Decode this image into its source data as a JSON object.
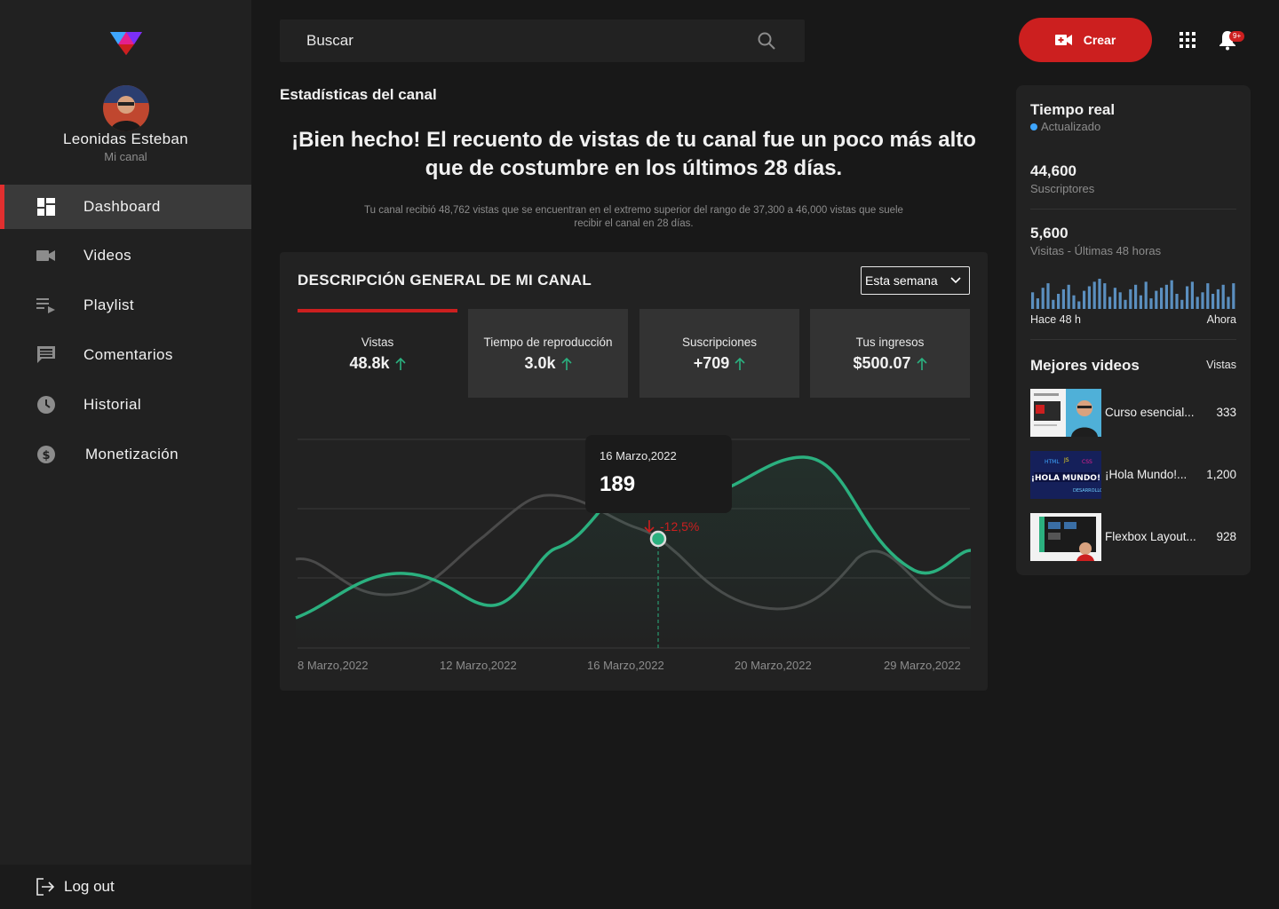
{
  "user": {
    "name": "Leonidas Esteban",
    "subtitle": "Mi canal"
  },
  "nav": [
    {
      "label": "Dashboard",
      "icon": "dashboard-icon",
      "active": true
    },
    {
      "label": "Videos",
      "icon": "video-camera-icon"
    },
    {
      "label": "Playlist",
      "icon": "playlist-icon"
    },
    {
      "label": "Comentarios",
      "icon": "comment-icon"
    },
    {
      "label": "Historial",
      "icon": "clock-icon"
    },
    {
      "label": "Monetización",
      "icon": "dollar-icon"
    }
  ],
  "logout_label": "Log out",
  "search": {
    "placeholder": "Buscar"
  },
  "create_label": "Crear",
  "notifications_badge": "9+",
  "page_title": "Estadísticas del canal",
  "headline": "¡Bien hecho! El recuento de vistas de tu canal fue un poco más alto que de costumbre en los últimos 28 días.",
  "subline": "Tu canal recibió 48,762 vistas que se encuentran en el extremo superior del rango de 37,300 a 46,000 vistas que suele recibir el canal en 28 días.",
  "overview": {
    "title": "DESCRIPCIÓN GENERAL DE MI CANAL",
    "period": "Esta semana",
    "metrics": [
      {
        "label": "Vistas",
        "value": "48.8k",
        "active": true
      },
      {
        "label": "Tiempo de reproducción",
        "value": "3.0k"
      },
      {
        "label": "Suscripciones",
        "value": "+709"
      },
      {
        "label": "Tus ingresos",
        "value": "$500.07"
      }
    ],
    "tooltip": {
      "date": "16 Marzo,2022",
      "value": "189",
      "delta": "-12,5%"
    }
  },
  "chart_data": {
    "type": "line",
    "x_tick_labels": [
      "8 Marzo,2022",
      "12 Marzo,2022",
      "16 Marzo,2022",
      "20 Marzo,2022",
      "29 Marzo,2022"
    ],
    "grid": true,
    "colors": {
      "current": "#2bb07f",
      "previous": "#4a4a4a"
    },
    "highlight": {
      "x_label": "16 Marzo,2022",
      "value": 189
    }
  },
  "realtime": {
    "title": "Tiempo real",
    "status": "Actualizado",
    "subscribers_value": "44,600",
    "subscribers_label": "Suscriptores",
    "views_value": "5,600",
    "views_label": "Visitas - Últimas 48 horas",
    "range_start": "Hace 48 h",
    "range_end": "Ahora",
    "bar_color": "#5b8fbf"
  },
  "best_videos": {
    "title": "Mejores videos",
    "column": "Vistas",
    "items": [
      {
        "title": "Curso esencial...",
        "views": "333"
      },
      {
        "title": "¡Hola Mundo!...",
        "views": "1,200"
      },
      {
        "title": "Flexbox Layout...",
        "views": "928"
      }
    ]
  },
  "colors": {
    "accent": "#cc1f1f",
    "green": "#2bb07f"
  }
}
